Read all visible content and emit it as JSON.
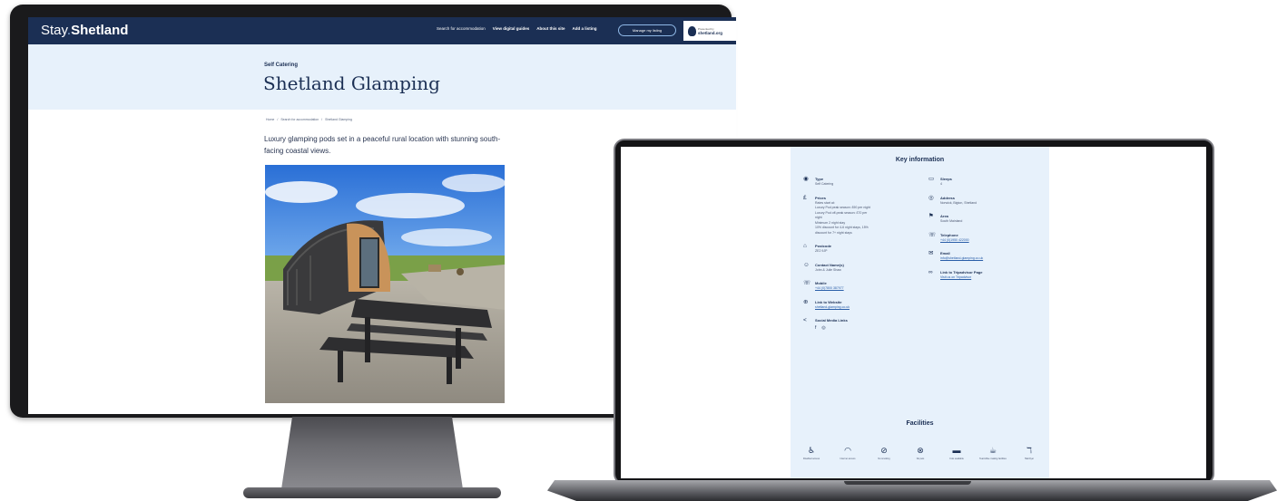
{
  "desktop": {
    "logo": {
      "part1": "Stay",
      "sep": ".",
      "part2": "Shetland"
    },
    "nav": {
      "links": [
        "Search for accommodation",
        "View digital guides",
        "About this site",
        "Add a listing"
      ],
      "cta": "Manage my listing",
      "partner_small": "Presented by",
      "partner_name": "shetland.org"
    },
    "hero": {
      "kicker": "Self Catering",
      "title": "Shetland Glamping"
    },
    "breadcrumb": [
      "Home",
      "/",
      "Search for accommodation",
      "/",
      "Shetland Glamping"
    ],
    "lead": "Luxury glamping pods set in a peaceful rural location with stunning south-facing coastal views."
  },
  "laptop": {
    "key_title": "Key information",
    "left": [
      {
        "icon": "eye-icon",
        "glyph": "◉",
        "label": "Type",
        "lines": [
          "Self Catering"
        ]
      },
      {
        "icon": "pound-icon",
        "glyph": "£",
        "label": "Prices",
        "lines": [
          "Rates start at:",
          "Luxury Pod peak season: £90 per night",
          "Luxury Pod off-peak season: £70 per",
          "night",
          "Minimum 2 night stay",
          "10% discount for 4-6 night stays, 15%",
          "discount for 7+ night stays"
        ]
      },
      {
        "icon": "postcode-icon",
        "glyph": "⌂",
        "label": "Postcode",
        "lines": [
          "ZE2 9JP"
        ]
      },
      {
        "icon": "contact-icon",
        "glyph": "☺",
        "label": "Contact Name(s)",
        "lines": [
          "John & Julie Shaw"
        ]
      },
      {
        "icon": "mobile-icon",
        "glyph": "☏",
        "label": "Mobile",
        "links": [
          "+44 (0)7800 387977"
        ]
      },
      {
        "icon": "globe-icon",
        "glyph": "⊕",
        "label": "Link to Website",
        "links": [
          "shetland-glamping.co.uk"
        ]
      },
      {
        "icon": "share-icon",
        "glyph": "<",
        "label": "Social Media Links",
        "social": [
          "f",
          "◎"
        ]
      }
    ],
    "right": [
      {
        "icon": "sleeps-icon",
        "glyph": "▭",
        "label": "Sleeps",
        "lines": [
          "4"
        ]
      },
      {
        "icon": "pin-icon",
        "glyph": "◎",
        "label": "Address",
        "lines": [
          "Norwick, Bigton, Shetland"
        ]
      },
      {
        "icon": "flag-icon",
        "glyph": "⚑",
        "label": "Area",
        "lines": [
          "South Mainland"
        ]
      },
      {
        "icon": "phone-icon",
        "glyph": "☏",
        "label": "Telephone",
        "links": [
          "+44 (0)1950 422000"
        ]
      },
      {
        "icon": "mail-icon",
        "glyph": "✉",
        "label": "Email",
        "links": [
          "info@shetland-glamping.co.uk"
        ]
      },
      {
        "icon": "tripadvisor-icon",
        "glyph": "∞",
        "label": "Link to Tripadvisor Page",
        "links": [
          "Visit us on Tripadvisor"
        ]
      }
    ],
    "facilities_title": "Facilities",
    "facilities": [
      {
        "icon": "accessible-icon",
        "glyph": "♿",
        "label": "Disabled access"
      },
      {
        "icon": "wifi-icon",
        "glyph": "◠",
        "label": "Internet access"
      },
      {
        "icon": "no-smoking-icon",
        "glyph": "⊘",
        "label": "No smoking"
      },
      {
        "icon": "no-pets-icon",
        "glyph": "⊗",
        "label": "No pets"
      },
      {
        "icon": "cots-icon",
        "glyph": "▬",
        "label": "Cots available"
      },
      {
        "icon": "tea-icon",
        "glyph": "☕",
        "label": "Tea/coffee making facilities"
      },
      {
        "icon": "hairdryer-icon",
        "glyph": "ℸ",
        "label": "Hairdryer"
      }
    ]
  }
}
